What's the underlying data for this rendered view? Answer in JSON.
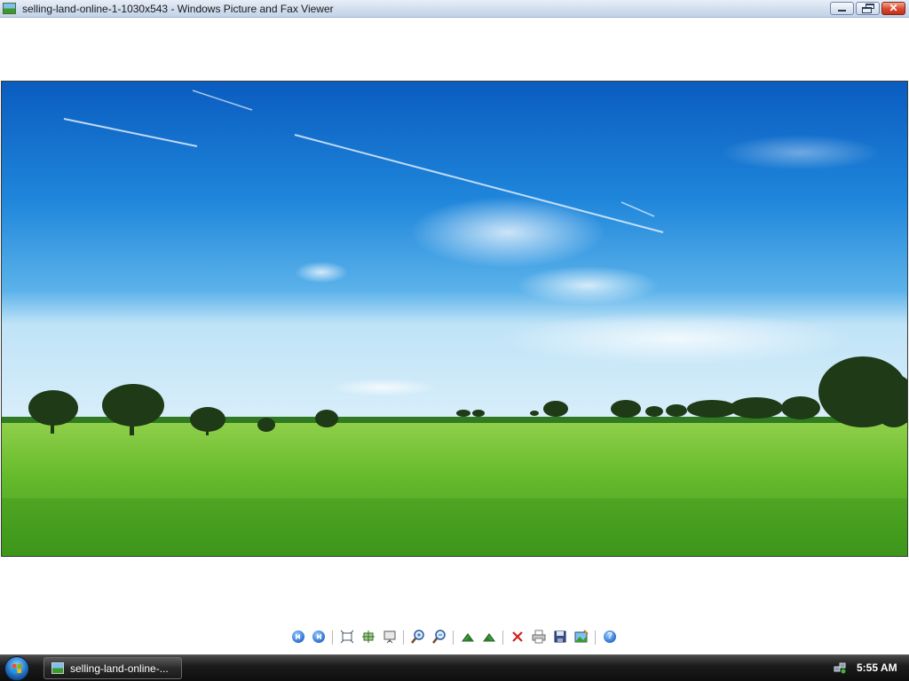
{
  "window": {
    "title": "selling-land-online-1-1030x543 - Windows Picture and Fax Viewer",
    "minimize_icon": "minimize-icon",
    "maximize_icon": "restore-icon",
    "close_icon": "close-icon",
    "close_glyph": "✕"
  },
  "image": {
    "subject": "green wheat field under blue sky",
    "colors": {
      "sky_top": "#0a5fc0",
      "sky_mid": "#2a8ee0",
      "horizon": "#bfe3f7",
      "field": "#5cb82a",
      "field_dark": "#2f7a18"
    }
  },
  "toolbar": {
    "buttons": [
      {
        "name": "previous-image-button",
        "icon": "previous-icon",
        "tip": "Previous Image"
      },
      {
        "name": "next-image-button",
        "icon": "next-icon",
        "tip": "Next Image"
      },
      {
        "name": "best-fit-button",
        "icon": "best-fit-icon",
        "tip": "Best Fit"
      },
      {
        "name": "actual-size-button",
        "icon": "actual-size-icon",
        "tip": "Actual Size"
      },
      {
        "name": "slideshow-button",
        "icon": "slideshow-icon",
        "tip": "Start Slide Show"
      },
      {
        "name": "zoom-in-button",
        "icon": "zoom-in-icon",
        "tip": "Zoom In"
      },
      {
        "name": "zoom-out-button",
        "icon": "zoom-out-icon",
        "tip": "Zoom Out"
      },
      {
        "name": "rotate-clockwise-button",
        "icon": "rotate-clockwise-icon",
        "tip": "Rotate Clockwise"
      },
      {
        "name": "rotate-counterclockwise-button",
        "icon": "rotate-counterclockwise-icon",
        "tip": "Rotate Counterclockwise"
      },
      {
        "name": "delete-button",
        "icon": "delete-icon",
        "tip": "Delete"
      },
      {
        "name": "print-button",
        "icon": "print-icon",
        "tip": "Print"
      },
      {
        "name": "save-button",
        "icon": "save-icon",
        "tip": "Copy To"
      },
      {
        "name": "edit-button",
        "icon": "edit-icon",
        "tip": "Edit"
      },
      {
        "name": "help-button",
        "icon": "help-icon",
        "tip": "Help"
      }
    ],
    "help_glyph": "?"
  },
  "taskbar": {
    "start_icon": "windows-start-icon",
    "task_label": "selling-land-online-...",
    "tray_icon": "network-icon",
    "clock": "5:55 AM"
  }
}
